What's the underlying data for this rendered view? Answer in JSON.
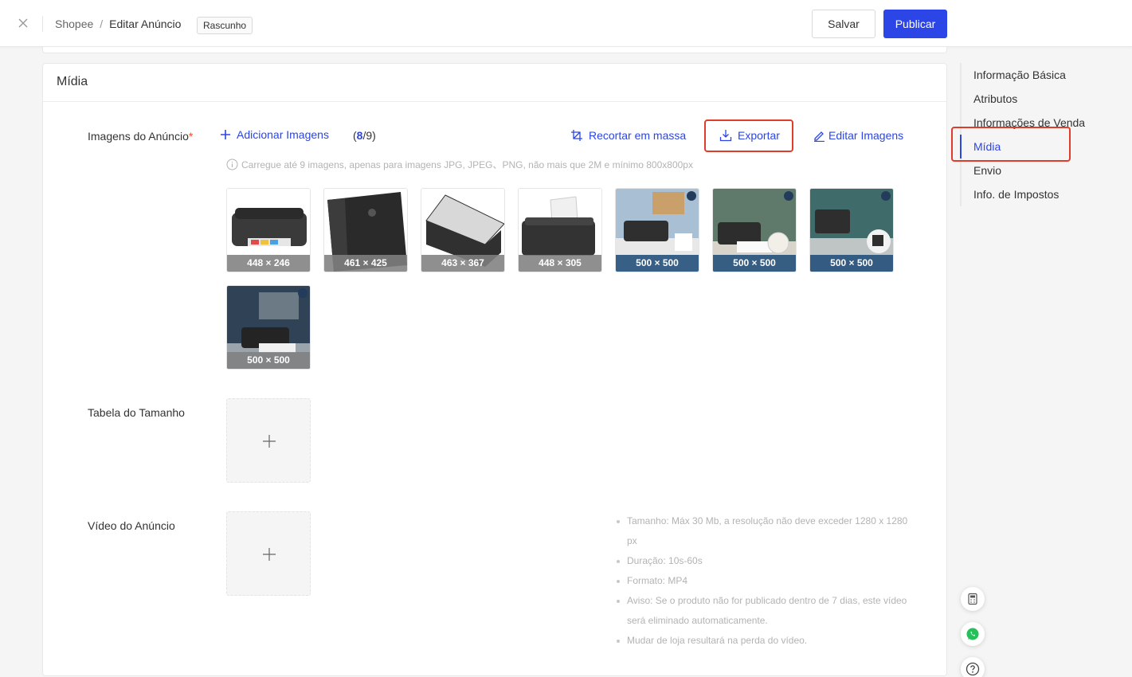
{
  "header": {
    "breadcrumb": [
      "Shopee",
      "Editar Anúncio"
    ],
    "separator": "/",
    "status_tag": "Rascunho",
    "save_label": "Salvar",
    "publish_label": "Publicar"
  },
  "media": {
    "title": "Mídia",
    "images": {
      "label": "Imagens do Anúncio",
      "required_mark": "*",
      "add_label": "Adicionar Imagens",
      "count_open": "(",
      "count_current": "8",
      "count_total": "/9)",
      "bulk_crop_label": "Recortar em massa",
      "export_label": "Exportar",
      "edit_label": "Editar Imagens",
      "hint": "Carregue até 9 imagens, apenas para imagens JPG, JPEG、PNG, não mais que 2M e mínimo 800x800px",
      "thumbnails": [
        {
          "dimensions": "448 × 246",
          "style": "grey"
        },
        {
          "dimensions": "461 × 425",
          "style": "grey"
        },
        {
          "dimensions": "463 × 367",
          "style": "grey"
        },
        {
          "dimensions": "448 × 305",
          "style": "grey"
        },
        {
          "dimensions": "500 × 500",
          "style": "blue"
        },
        {
          "dimensions": "500 × 500",
          "style": "blue"
        },
        {
          "dimensions": "500 × 500",
          "style": "blue"
        },
        {
          "dimensions": "500 × 500",
          "style": "grey"
        }
      ]
    },
    "size_chart": {
      "label": "Tabela do Tamanho"
    },
    "video": {
      "label": "Vídeo do Anúncio",
      "notes": [
        "Tamanho: Máx 30 Mb, a resolução não deve exceder 1280 x 1280 px",
        "Duração: 10s-60s",
        "Formato: MP4",
        "Aviso: Se o produto não for publicado dentro de 7 dias, este vídeo será eliminado automaticamente.",
        "Mudar de loja resultará na perda do vídeo."
      ]
    }
  },
  "sidenav": {
    "items": [
      "Informação Básica",
      "Atributos",
      "Informações de Venda",
      "Mídia",
      "Envio",
      "Info. de Impostos"
    ],
    "active_index": 3
  },
  "colors": {
    "accent": "#2b45e6",
    "highlight": "#e03c2a",
    "required": "#ee4d2d"
  }
}
